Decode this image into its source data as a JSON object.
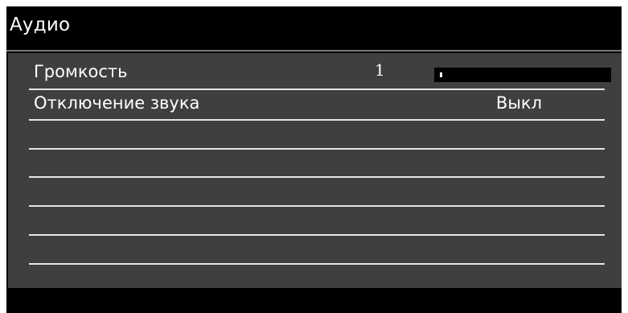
{
  "window": {
    "title": "Аудио"
  },
  "menu": {
    "items": [
      {
        "label": "Громкость",
        "value": "1",
        "level_fraction": 0.01
      },
      {
        "label": "Отключение звука",
        "value": "Выкл"
      }
    ]
  },
  "colors": {
    "background": "#000000",
    "panel": "#3f3f3f",
    "text": "#ffffff",
    "separator": "#e6e6e6"
  }
}
